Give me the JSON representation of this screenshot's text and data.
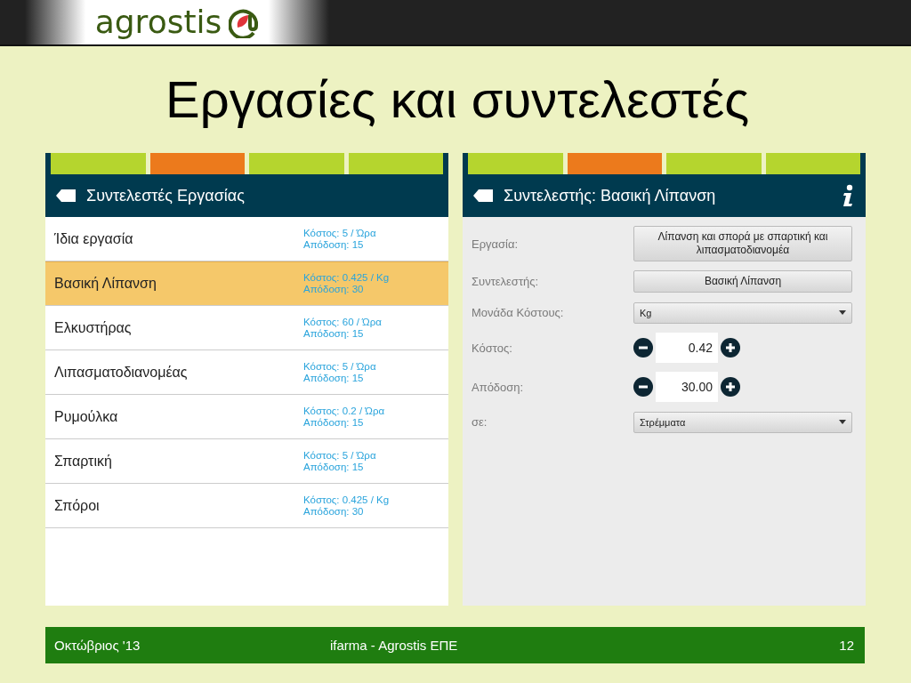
{
  "header": {
    "logo_text": "agrostis"
  },
  "title": "Εργασίες και συντελεστές",
  "screens": [
    {
      "tabs": [
        {
          "selected": false
        },
        {
          "selected": true
        },
        {
          "selected": false
        },
        {
          "selected": false
        }
      ],
      "title": "Συντελεστές Εργασίας",
      "info": false,
      "rows": [
        {
          "name": "Ίδια εργασία",
          "cost": "Κόστος: 5 / Ώρα",
          "yield": "Απόδοση: 15",
          "selected": false
        },
        {
          "name": "Βασική Λίπανση",
          "cost": "Κόστος: 0.425 / Kg",
          "yield": "Απόδοση: 30",
          "selected": true
        },
        {
          "name": "Ελκυστήρας",
          "cost": "Κόστος: 60 / Ώρα",
          "yield": "Απόδοση: 15",
          "selected": false
        },
        {
          "name": "Λιπασματοδιανομέας",
          "cost": "Κόστος: 5 / Ώρα",
          "yield": "Απόδοση: 15",
          "selected": false
        },
        {
          "name": "Ρυμούλκα",
          "cost": "Κόστος: 0.2 / Ώρα",
          "yield": "Απόδοση: 15",
          "selected": false
        },
        {
          "name": "Σπαρτική",
          "cost": "Κόστος: 5 / Ώρα",
          "yield": "Απόδοση: 15",
          "selected": false
        },
        {
          "name": "Σπόροι",
          "cost": "Κόστος: 0.425 / Kg",
          "yield": "Απόδοση: 30",
          "selected": false
        }
      ]
    },
    {
      "tabs": [
        {
          "selected": false
        },
        {
          "selected": true
        },
        {
          "selected": false
        },
        {
          "selected": false
        }
      ],
      "title": "Συντελεστής: Βασική Λίπανση",
      "info": true,
      "fields": [
        {
          "kind": "button",
          "label": "Εργασία:",
          "value": "Λίπανση και σπορά με σπαρτική και λιπασματοδιανομέα"
        },
        {
          "kind": "button",
          "label": "Συντελεστής:",
          "value": "Βασική Λίπανση"
        },
        {
          "kind": "select",
          "label": "Μονάδα Κόστους:",
          "value": "Kg"
        },
        {
          "kind": "stepper",
          "label": "Κόστος:",
          "value": "0.42"
        },
        {
          "kind": "stepper",
          "label": "Απόδοση:",
          "value": "30.00"
        },
        {
          "kind": "select",
          "label": "σε:",
          "value": "Στρέμματα"
        }
      ]
    }
  ],
  "footer": {
    "date": "Οκτώβριος '13",
    "center": "ifarma - Agrostis ΕΠΕ",
    "page": "12"
  }
}
